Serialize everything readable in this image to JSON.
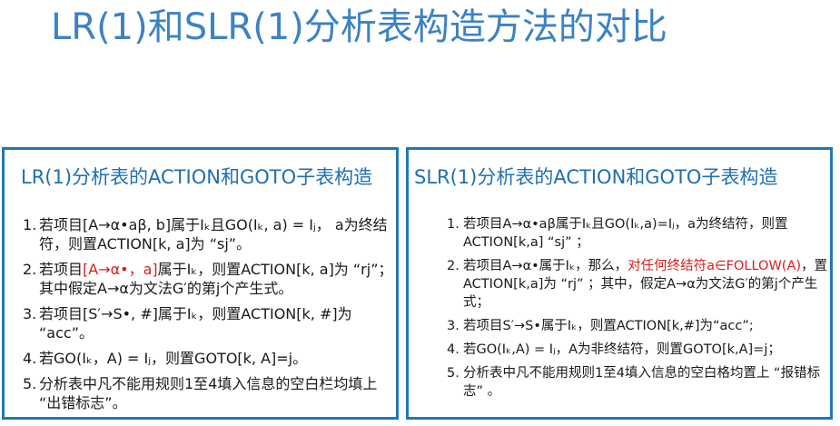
{
  "title": "LR(1)和SLR(1)分析表构造方法的对比",
  "left": {
    "heading": "LR(1)分析表的ACTION和GOTO子表构造",
    "items": [
      {
        "num": "1.",
        "text": "若项目[A→α•aβ, b]属于Iₖ且GO(Iₖ, a) = Iⱼ， a为终结符，则置ACTION[k, a]为 “sj”。"
      },
      {
        "num": "2.",
        "pre": "若项目",
        "red": "[A→α•，a]",
        "post": "属于Iₖ，则置ACTION[k, a]为 “rj”；其中假定A→α为文法G′的第j个产生式。"
      },
      {
        "num": "3.",
        "text": "若项目[S′→S•, #]属于Iₖ，则置ACTION[k, #]为 “acc”。"
      },
      {
        "num": "4.",
        "text": "若GO(Iₖ，A) = Iⱼ，则置GOTO[k, A]=j。"
      },
      {
        "num": "5.",
        "text": "分析表中凡不能用规则1至4填入信息的空白栏均填上 “出错标志”。"
      }
    ]
  },
  "right": {
    "heading": "SLR(1)分析表的ACTION和GOTO子表构造",
    "items": [
      {
        "num": "1.",
        "text": "若项目A→α•aβ属于Iₖ且GO(Iₖ,a)=Iⱼ，a为终结符，则置ACTION[k,a] “sj” ；"
      },
      {
        "num": "2.",
        "pre": "若项目A→α•属于Iₖ，那么，",
        "red": "对任何终结符a∈FOLLOW(A)",
        "post": "，置ACTION[k,a]为 “rj” ；其中，假定A→α为文法G′的第j个产生式；"
      },
      {
        "num": "3.",
        "text": "若项目S′→S•属于Iₖ，则置ACTION[k,#]为“acc”;"
      },
      {
        "num": "4.",
        "text": "若GO(Iₖ,A) = Iⱼ，A为非终结符，则置GOTO[k,A]=j；"
      },
      {
        "num": "5.",
        "text": "分析表中凡不能用规则1至4填入信息的空白格均置上 “报错标志” 。"
      }
    ]
  }
}
